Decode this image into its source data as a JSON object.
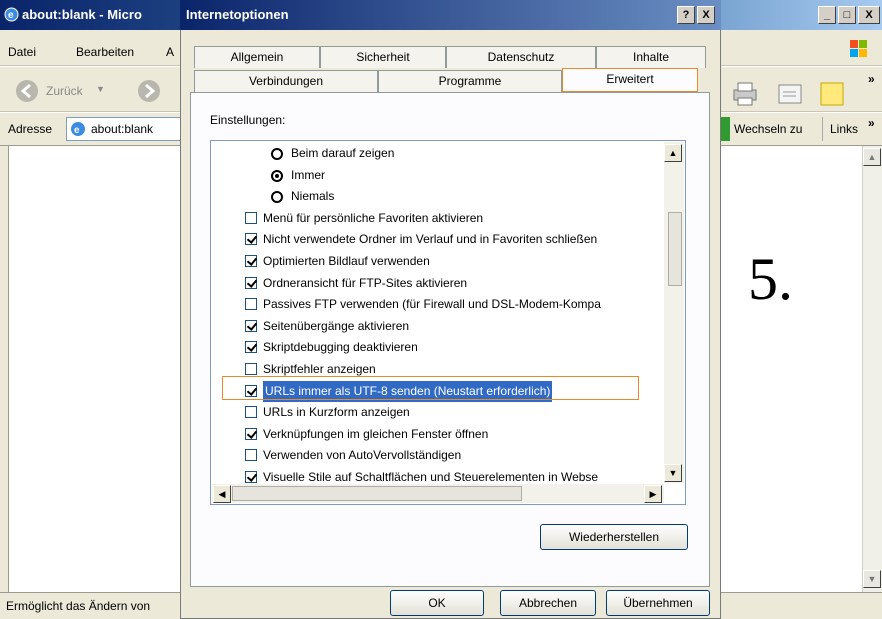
{
  "ie": {
    "title": "about:blank - Micro",
    "menu": [
      "Datei",
      "Bearbeiten",
      "A"
    ],
    "back_label": "Zurück",
    "address_label": "Adresse",
    "address_value": "about:blank",
    "go_label": "Wechseln zu",
    "links_label": "Links",
    "chevron": "»",
    "status": "Ermöglicht das Ändern von"
  },
  "dialog": {
    "title": "Internetoptionen",
    "help_btn": "?",
    "close_btn": "X",
    "tabs_row1": [
      "Allgemein",
      "Sicherheit",
      "Datenschutz",
      "Inhalte"
    ],
    "tabs_row2": [
      "Verbindungen",
      "Programme",
      "Erweitert"
    ],
    "active_tab": "Erweitert",
    "settings_label": "Einstellungen:",
    "items": [
      {
        "type": "radio",
        "checked": false,
        "label": "Beim darauf zeigen"
      },
      {
        "type": "radio",
        "checked": true,
        "label": "Immer"
      },
      {
        "type": "radio",
        "checked": false,
        "label": "Niemals"
      },
      {
        "type": "checkbox",
        "checked": false,
        "label": "Menü für persönliche Favoriten aktivieren"
      },
      {
        "type": "checkbox",
        "checked": true,
        "label": "Nicht verwendete Ordner im Verlauf und in Favoriten schließen"
      },
      {
        "type": "checkbox",
        "checked": true,
        "label": "Optimierten Bildlauf verwenden"
      },
      {
        "type": "checkbox",
        "checked": true,
        "label": "Ordneransicht für FTP-Sites aktivieren"
      },
      {
        "type": "checkbox",
        "checked": false,
        "label": "Passives FTP verwenden (für Firewall und DSL-Modem-Kompa"
      },
      {
        "type": "checkbox",
        "checked": true,
        "label": "Seitenübergänge aktivieren"
      },
      {
        "type": "checkbox",
        "checked": true,
        "label": "Skriptdebugging deaktivieren"
      },
      {
        "type": "checkbox",
        "checked": false,
        "label": "Skriptfehler anzeigen"
      },
      {
        "type": "checkbox",
        "checked": true,
        "label": "URLs immer als UTF-8 senden (Neustart erforderlich)",
        "selected": true
      },
      {
        "type": "checkbox",
        "checked": false,
        "label": "URLs in Kurzform anzeigen"
      },
      {
        "type": "checkbox",
        "checked": true,
        "label": "Verknüpfungen im gleichen Fenster öffnen"
      },
      {
        "type": "checkbox",
        "checked": false,
        "label": "Verwenden von AutoVervollständigen"
      },
      {
        "type": "checkbox",
        "checked": true,
        "label": "Visuelle Stile auf Schaltflächen und Steuerelementen in Webse"
      }
    ],
    "restore_btn": "Wiederherstellen",
    "ok_btn": "OK",
    "cancel_btn": "Abbrechen",
    "apply_btn": "Übernehmen"
  },
  "annotation": "5.",
  "colors": {
    "titlebar": "#0a246a",
    "selection": "#316ac5",
    "highlight_frame": "#e68b2c",
    "dialog_bg": "#ece9d8"
  }
}
